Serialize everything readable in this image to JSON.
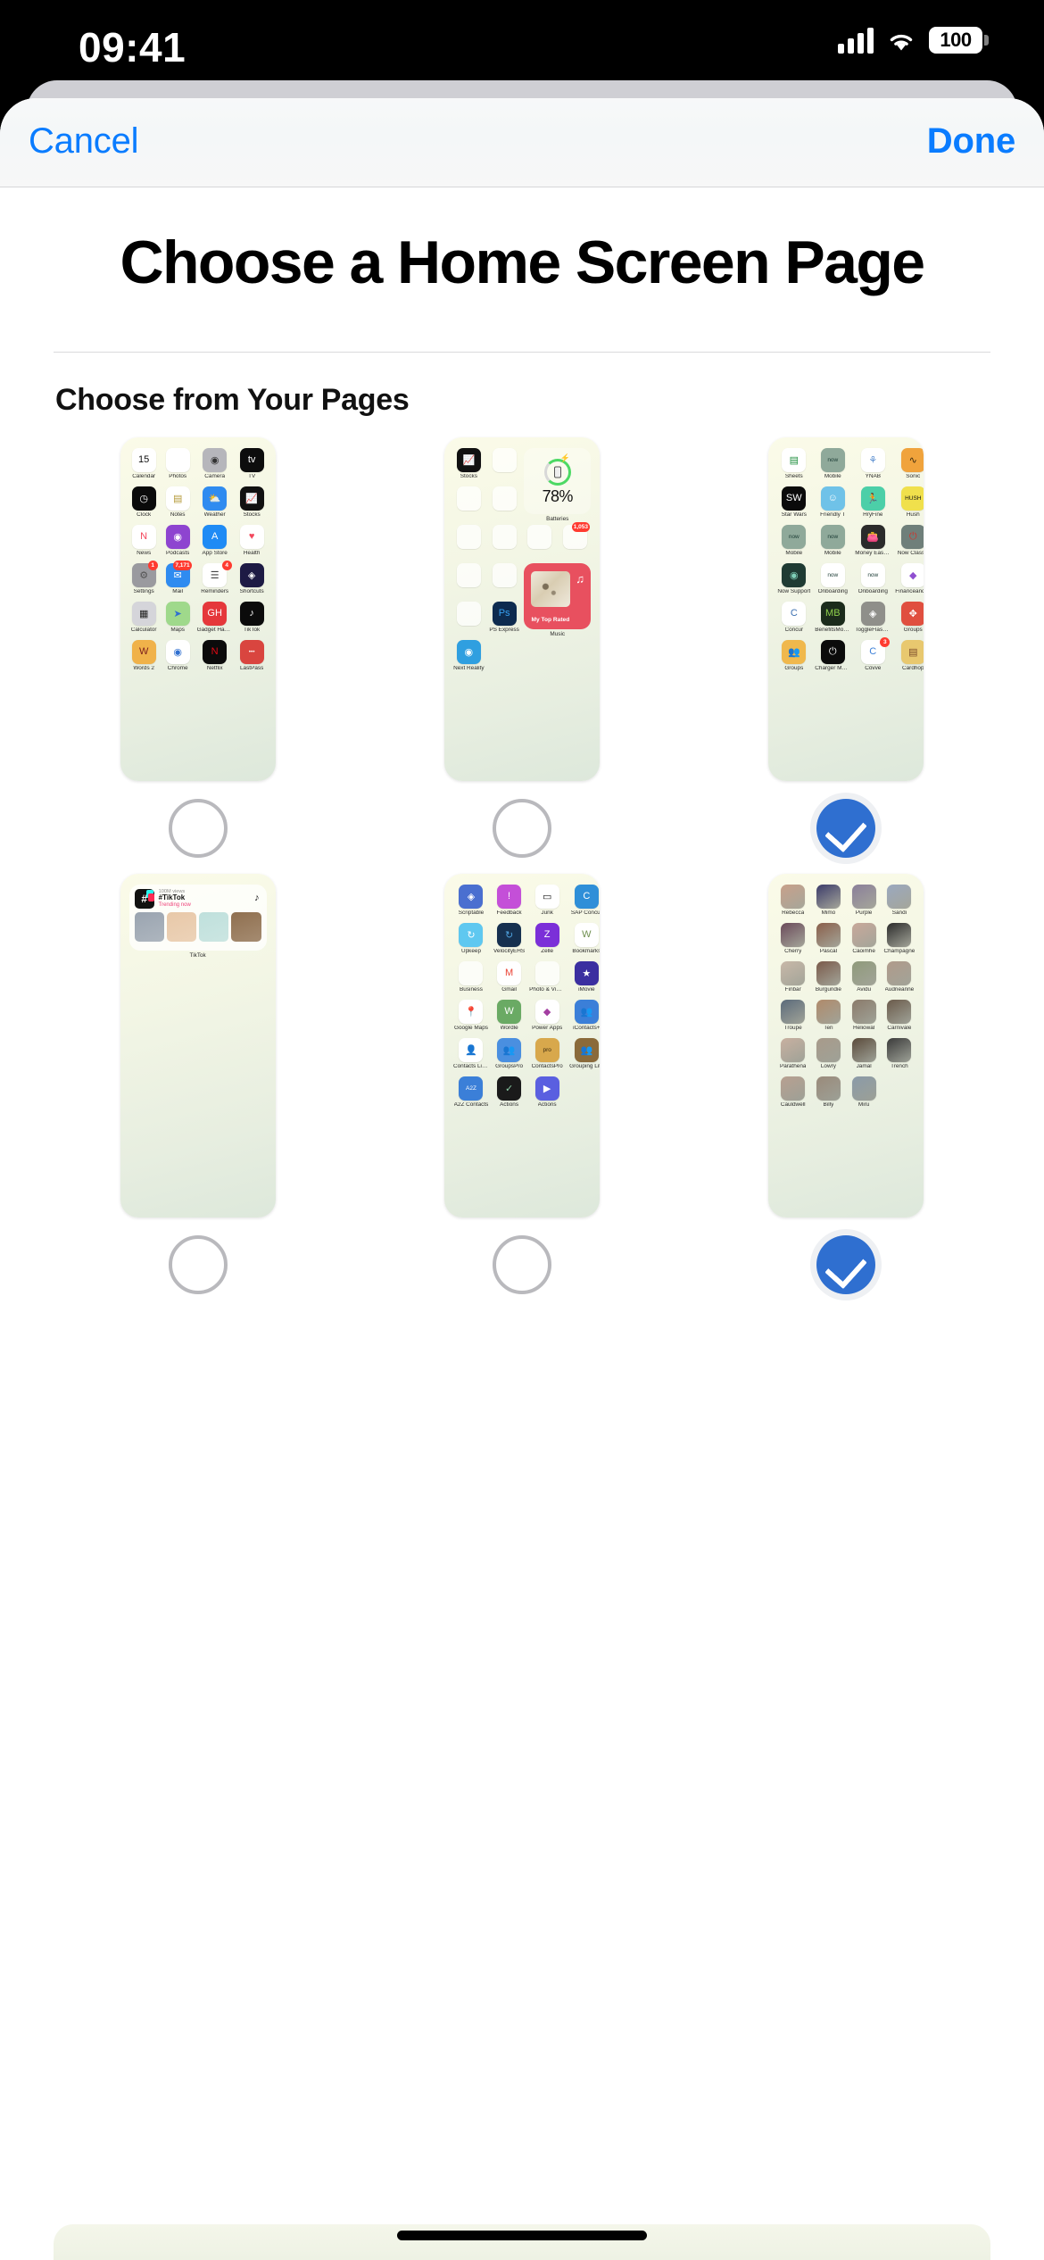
{
  "status_bar": {
    "time": "09:41",
    "battery": "100",
    "cellular_icon": "cellular-bars-icon",
    "wifi_icon": "wifi-icon"
  },
  "nav": {
    "cancel_label": "Cancel",
    "done_label": "Done"
  },
  "title": "Choose a Home Screen Page",
  "section_header": "Choose from Your Pages",
  "accent_color": "#2f6fd0",
  "link_color": "#0a7cff",
  "pages": [
    {
      "id": "page-1",
      "selected": false,
      "apps": [
        {
          "label": "Calendar",
          "icon": "calendar-icon",
          "bg": "#ffffff",
          "fg": "#111",
          "glyph": "15"
        },
        {
          "label": "Photos",
          "icon": "photos-icon",
          "bg": "#ffffff",
          "fg": "#fff",
          "glyph": "❋"
        },
        {
          "label": "Camera",
          "icon": "camera-icon",
          "bg": "#b6b6bb",
          "fg": "#333",
          "glyph": "◉"
        },
        {
          "label": "TV",
          "icon": "apple-tv-icon",
          "bg": "#0d0d0d",
          "fg": "#fff",
          "glyph": "tv"
        },
        {
          "label": "Clock",
          "icon": "clock-icon",
          "bg": "#0a0a0a",
          "fg": "#fff",
          "glyph": "◷"
        },
        {
          "label": "Notes",
          "icon": "notes-icon",
          "bg": "#ffffff",
          "fg": "#b59a3a",
          "glyph": "▤"
        },
        {
          "label": "Weather",
          "icon": "weather-icon",
          "bg": "#2f8bf0",
          "fg": "#fff",
          "glyph": "⛅"
        },
        {
          "label": "Stocks",
          "icon": "stocks-icon",
          "bg": "#111111",
          "fg": "#fff",
          "glyph": "📈"
        },
        {
          "label": "News",
          "icon": "news-icon",
          "bg": "#ffffff",
          "fg": "#f4465c",
          "glyph": "N"
        },
        {
          "label": "Podcasts",
          "icon": "podcasts-icon",
          "bg": "#8e44d0",
          "fg": "#fff",
          "glyph": "◉"
        },
        {
          "label": "App Store",
          "icon": "app-store-icon",
          "bg": "#1f8bf5",
          "fg": "#fff",
          "glyph": "A"
        },
        {
          "label": "Health",
          "icon": "health-icon",
          "bg": "#ffffff",
          "fg": "#f2485d",
          "glyph": "♥"
        },
        {
          "label": "Settings",
          "icon": "settings-icon",
          "bg": "#9a9a9f",
          "fg": "#555",
          "glyph": "⚙",
          "badge": "1"
        },
        {
          "label": "Mail",
          "icon": "mail-icon",
          "bg": "#2f8bf0",
          "fg": "#fff",
          "glyph": "✉",
          "badge": "7,171",
          "badge_wide": true
        },
        {
          "label": "Reminders",
          "icon": "reminders-icon",
          "bg": "#ffffff",
          "fg": "#444",
          "glyph": "☰",
          "badge": "4"
        },
        {
          "label": "Shortcuts",
          "icon": "shortcuts-icon",
          "bg": "#1d1a44",
          "fg": "#fff",
          "glyph": "◈"
        },
        {
          "label": "Calculator",
          "icon": "calculator-icon",
          "bg": "#d5d5da",
          "fg": "#222",
          "glyph": "▦"
        },
        {
          "label": "Maps",
          "icon": "maps-icon",
          "bg": "#9fd98b",
          "fg": "#2f6fd0",
          "glyph": "➤"
        },
        {
          "label": "Gadget Hacks",
          "icon": "gadget-hacks-icon",
          "bg": "#e5383b",
          "fg": "#fff",
          "glyph": "GH"
        },
        {
          "label": "TikTok",
          "icon": "tiktok-icon",
          "bg": "#0b0b0b",
          "fg": "#fff",
          "glyph": "♪"
        },
        {
          "label": "Words 2",
          "icon": "words-2-icon",
          "bg": "#f0b24a",
          "fg": "#7a1d1d",
          "glyph": "W"
        },
        {
          "label": "Chrome",
          "icon": "chrome-icon",
          "bg": "#ffffff",
          "fg": "#2f6fd0",
          "glyph": "◉"
        },
        {
          "label": "Netflix",
          "icon": "netflix-icon",
          "bg": "#0b0b0b",
          "fg": "#e50914",
          "glyph": "N"
        },
        {
          "label": "LastPass",
          "icon": "lastpass-icon",
          "bg": "#d9453f",
          "fg": "#fff",
          "glyph": "•••"
        }
      ]
    },
    {
      "id": "page-2",
      "selected": false,
      "apps": [
        {
          "label": "Stocks",
          "icon": "stocks-icon",
          "bg": "#111111",
          "fg": "#fff",
          "glyph": "📈"
        },
        {
          "label": "",
          "icon": "folder-icon",
          "folder": [
            "#2d6fa3",
            "#3b3b3b",
            "#222222",
            "#9bd4a8",
            "#7fcf9a",
            "#8a8a8a",
            "#3a2a2a",
            "#f0c63c",
            "#cfcfcf"
          ]
        },
        {
          "label": "Batteries",
          "icon": "batteries-widget",
          "widget": "battery",
          "value": "78%"
        },
        {
          "label": "",
          "icon": "folder-icon",
          "folder": [
            "#4fb3e8",
            "#5ac85a",
            "#6fa8dc",
            "#45c45a",
            "#6fc36f",
            "#7c4fd0",
            "#3cb44b",
            "#2f9fe0",
            "#3bb54a"
          ]
        },
        {
          "label": "",
          "icon": "folder-icon",
          "folder": [
            "#e0453b",
            "#3b7dd8",
            "#f0c040",
            "#4a7fd0",
            "#6f4fd0",
            "#2f9ecf",
            "#101010",
            "#2b2b2b",
            "#cfcfcf"
          ]
        },
        {
          "label": "",
          "icon": "folder-icon",
          "folder": [
            "#f0a33c",
            "#3f7fd0",
            "#c34f3f",
            "#6fbf5f",
            "#e8c43c",
            "#3b6fd0",
            "#f0a33c",
            "#3f9fbf",
            "#7c3fd0"
          ]
        },
        {
          "label": "",
          "icon": "folder-icon",
          "folder": [
            "#4a8fe0",
            "#e05fa8",
            "#e04848",
            "#3f4fbf",
            "#4aa3e0",
            "#f08a3c",
            "#e8a64c",
            "#3fa34c",
            "#cfcfcf"
          ]
        },
        {
          "label": "",
          "icon": "folder-icon",
          "folder": [
            "#e8d84c",
            "#e05f5f",
            "#cfd4d8",
            "#9fb0bf",
            "#4fa3e0",
            "#4fbfd0",
            "#3f8fd0",
            "#1a1a1a",
            "#cfcfcf"
          ]
        },
        {
          "label": "",
          "icon": "folder-icon",
          "badge": "1,053",
          "badge_wide": true,
          "folder": [
            "#e8e0d0",
            "#c8c0b0",
            "#e8d0b0",
            "#e8903c",
            "#e05f5f",
            "#e04848",
            "#2b2b2b",
            "#8f8f8f",
            "#6f6f6f"
          ]
        },
        {
          "label": "",
          "icon": "folder-icon",
          "folder": [
            "#e04f4f",
            "#b0b0b0",
            "#e08a4c",
            "#e8a84c",
            "#3f8fd0",
            "#e05f5f",
            "#e8d8c8",
            "#cfcfcf",
            "#cfcfcf"
          ]
        },
        {
          "label": "",
          "icon": "folder-icon",
          "folder": [
            "#3fa34c",
            "#9f9f9f",
            "#e05f7f",
            "#e0453b",
            "#cfcfcf",
            "#8fbf6f",
            "#2b2b2b",
            "#e0456f",
            "#b07fd0"
          ]
        },
        {
          "label": "Music",
          "icon": "music-widget",
          "widget": "music",
          "value": "My Top Rated"
        },
        {
          "label": "",
          "icon": "folder-icon",
          "folder": [
            "#2b2b2b",
            "#4f6f9f",
            "#3f3f3f",
            "#cfcfcf",
            "#e8a84c",
            "#4f6f8f",
            "#6f8f4f",
            "#cfcfcf",
            "#2b2b2b"
          ]
        },
        {
          "label": "PS Express",
          "icon": "ps-express-icon",
          "bg": "#0d2b4f",
          "fg": "#38a0f0",
          "glyph": "Ps"
        },
        {
          "label": "Next Reality",
          "icon": "next-reality-icon",
          "bg": "#2f9fe0",
          "fg": "#fff",
          "glyph": "◉"
        }
      ]
    },
    {
      "id": "page-3",
      "selected": true,
      "apps": [
        {
          "label": "Sheets",
          "icon": "sheets-icon",
          "bg": "#ffffff",
          "fg": "#1e8e3e",
          "glyph": "▤"
        },
        {
          "label": "Mobile",
          "icon": "now-mobile-icon",
          "bg": "#8fa99a",
          "fg": "#1b3b34",
          "glyph": "now"
        },
        {
          "label": "YNAB",
          "icon": "ynab-icon",
          "bg": "#ffffff",
          "fg": "#5b8fd0",
          "glyph": "⚘"
        },
        {
          "label": "Sonic",
          "icon": "sonic-icon",
          "bg": "#f0a33c",
          "fg": "#3a2a10",
          "glyph": "∿"
        },
        {
          "label": "Star Wars",
          "icon": "star-wars-icon",
          "bg": "#0b0b0b",
          "fg": "#fff",
          "glyph": "SW"
        },
        {
          "label": "Friendly T",
          "icon": "friendly-t-icon",
          "bg": "#6fc2e8",
          "fg": "#fff",
          "glyph": "☺"
        },
        {
          "label": "HryFine",
          "icon": "hryfine-icon",
          "bg": "#4ccfa8",
          "fg": "#fff",
          "glyph": "🏃"
        },
        {
          "label": "Hush",
          "icon": "hush-icon",
          "bg": "#f0e04c",
          "fg": "#111",
          "glyph": "HUSH"
        },
        {
          "label": "Mobile",
          "icon": "now-mobile-icon",
          "bg": "#8fa99a",
          "fg": "#1b3b34",
          "glyph": "now"
        },
        {
          "label": "Mobile",
          "icon": "now-mobile-icon",
          "bg": "#8fa99a",
          "fg": "#1b3b34",
          "glyph": "now"
        },
        {
          "label": "Money Easy Lite",
          "icon": "money-easy-lite-icon",
          "bg": "#2b2b2b",
          "fg": "#e8a84c",
          "glyph": "👛"
        },
        {
          "label": "Now Classic",
          "icon": "now-classic-icon",
          "bg": "#6f7f7a",
          "fg": "#d0342c",
          "glyph": "⏻"
        },
        {
          "label": "Now Support",
          "icon": "now-support-icon",
          "bg": "#1f3b33",
          "fg": "#7fd0b8",
          "glyph": "◉"
        },
        {
          "label": "Onboarding",
          "icon": "onboarding-icon",
          "bg": "#ffffff",
          "fg": "#1b3b34",
          "glyph": "now"
        },
        {
          "label": "Onboarding",
          "icon": "onboarding-icon",
          "bg": "#ffffff",
          "fg": "#1b3b34",
          "glyph": "now"
        },
        {
          "label": "FinanceandOp...",
          "icon": "finance-and-op-icon",
          "bg": "#ffffff",
          "fg": "#8f4fd0",
          "glyph": "◆"
        },
        {
          "label": "Concur",
          "icon": "concur-icon",
          "bg": "#ffffff",
          "fg": "#3b6fb0",
          "glyph": "C"
        },
        {
          "label": "BenefitsMobile",
          "icon": "benefits-mobile-icon",
          "bg": "#1b2b1b",
          "fg": "#8fd04c",
          "glyph": "MB"
        },
        {
          "label": "ToggleFlashAl...",
          "icon": "toggle-flash-icon",
          "bg": "#8f8f8a",
          "fg": "#fff",
          "glyph": "◈"
        },
        {
          "label": "Groups",
          "icon": "groups-icon",
          "bg": "#e04f3f",
          "fg": "#fff",
          "glyph": "✥"
        },
        {
          "label": "Groups",
          "icon": "groups-icon",
          "bg": "#f0b84c",
          "fg": "#fff",
          "glyph": "👥"
        },
        {
          "label": "Charger Master",
          "icon": "charger-master-icon",
          "bg": "#0b0b0b",
          "fg": "#fff",
          "glyph": "⏻"
        },
        {
          "label": "Covve",
          "icon": "covve-icon",
          "bg": "#ffffff",
          "fg": "#3b7fd8",
          "glyph": "C",
          "badge": "3"
        },
        {
          "label": "Cardhop",
          "icon": "cardhop-icon",
          "bg": "#e8c86f",
          "fg": "#7a4a2a",
          "glyph": "▤"
        }
      ]
    },
    {
      "id": "page-4",
      "selected": false,
      "widget_only": true,
      "widget": {
        "type": "tiktok",
        "label": "TikTok",
        "views": "100M views",
        "tag": "#TikTok",
        "trending": "Trending now",
        "thumb_colors": [
          "#9aa4b0",
          "#e8c8a8",
          "#bfe0dc",
          "#8f6f4f"
        ]
      },
      "apps": []
    },
    {
      "id": "page-5",
      "selected": false,
      "apps": [
        {
          "label": "Scriptable",
          "icon": "scriptable-icon",
          "bg": "#4a6fd0",
          "fg": "#fff",
          "glyph": "◈"
        },
        {
          "label": "Feedback",
          "icon": "feedback-icon",
          "bg": "#c44fd8",
          "fg": "#fff",
          "glyph": "!"
        },
        {
          "label": "Junk",
          "icon": "junk-icon",
          "bg": "#ffffff",
          "fg": "#111",
          "glyph": "▭"
        },
        {
          "label": "SAP Concur",
          "icon": "sap-concur-icon",
          "bg": "#2f8fd8",
          "fg": "#fff",
          "glyph": "C"
        },
        {
          "label": "Upkeep",
          "icon": "upkeep-icon",
          "bg": "#5fc8f0",
          "fg": "#fff",
          "glyph": "↻"
        },
        {
          "label": "VelocityEHS",
          "icon": "velocity-ehs-icon",
          "bg": "#16304f",
          "fg": "#4fa3e0",
          "glyph": "↻"
        },
        {
          "label": "Zelle",
          "icon": "zelle-icon",
          "bg": "#7b2fd8",
          "fg": "#fff",
          "glyph": "Z"
        },
        {
          "label": "Bookmarks",
          "icon": "bookmarks-icon",
          "bg": "#ffffff",
          "fg": "#6f8f4f",
          "glyph": "W"
        },
        {
          "label": "Business",
          "icon": "business-folder-icon",
          "folder": [
            "#1a1a1a",
            "#e07f7f",
            "#2b2b2b",
            "#cfcfcf",
            "#cfcfcf",
            "#cfcfcf",
            "#cfcfcf",
            "#cfcfcf",
            "#cfcfcf"
          ]
        },
        {
          "label": "Gmail",
          "icon": "gmail-icon",
          "bg": "#ffffff",
          "fg": "#ea4335",
          "glyph": "M"
        },
        {
          "label": "Photo & Video",
          "icon": "photo-video-folder-icon",
          "folder": [
            "#8f8f8f",
            "#4fa3e0",
            "#cfcfcf",
            "#cfcfcf",
            "#cfcfcf",
            "#cfcfcf",
            "#cfcfcf",
            "#cfcfcf",
            "#cfcfcf"
          ]
        },
        {
          "label": "iMovie",
          "icon": "imovie-icon",
          "bg": "#3b2fa0",
          "fg": "#fff",
          "glyph": "★"
        },
        {
          "label": "Google Maps",
          "icon": "google-maps-icon",
          "bg": "#ffffff",
          "fg": "#34a853",
          "glyph": "📍"
        },
        {
          "label": "Wordle",
          "icon": "wordle-icon",
          "bg": "#6aaa64",
          "fg": "#fff",
          "glyph": "W"
        },
        {
          "label": "Power Apps",
          "icon": "power-apps-icon",
          "bg": "#ffffff",
          "fg": "#a33ea1",
          "glyph": "◆"
        },
        {
          "label": "iContacts+",
          "icon": "icontacts-plus-icon",
          "bg": "#3b7fd8",
          "fg": "#fff",
          "glyph": "👥"
        },
        {
          "label": "Contacts List Pro",
          "icon": "contacts-list-pro-icon",
          "bg": "#ffffff",
          "fg": "#e8a84c",
          "glyph": "👤"
        },
        {
          "label": "GroupsPro",
          "icon": "groups-pro-icon",
          "bg": "#4a8fe0",
          "fg": "#fff",
          "glyph": "👥"
        },
        {
          "label": "ContactsPro",
          "icon": "contacts-pro-icon",
          "bg": "#d8a84c",
          "fg": "#3a2a10",
          "glyph": "pro"
        },
        {
          "label": "Grouping Lite",
          "icon": "grouping-lite-icon",
          "bg": "#8a6a3a",
          "fg": "#fff",
          "glyph": "👥"
        },
        {
          "label": "A2Z Contacts",
          "icon": "a2z-contacts-icon",
          "bg": "#3b7fd8",
          "fg": "#fff",
          "glyph": "A2Z"
        },
        {
          "label": "Actions",
          "icon": "actions-icon",
          "bg": "#1a1a1a",
          "fg": "#8fd0a8",
          "glyph": "✓"
        },
        {
          "label": "Actions",
          "icon": "actions-play-icon",
          "bg": "#5a5fe0",
          "fg": "#fff",
          "glyph": "▶"
        }
      ]
    },
    {
      "id": "page-6",
      "selected": true,
      "contacts": true,
      "apps": [
        {
          "label": "Rebecca",
          "icon": "contact-photo",
          "photo": "#c8a08a"
        },
        {
          "label": "Mimo",
          "icon": "contact-photo",
          "photo": "#3b3b6a"
        },
        {
          "label": "Purple",
          "icon": "contact-photo",
          "photo": "#8a7f9a"
        },
        {
          "label": "Sandi",
          "icon": "contact-photo",
          "photo": "#9aa8bf"
        },
        {
          "label": "Cherry",
          "icon": "contact-photo",
          "photo": "#6a4a5a"
        },
        {
          "label": "Pascal",
          "icon": "contact-photo",
          "photo": "#8a5f4a"
        },
        {
          "label": "Caoimhe",
          "icon": "contact-photo",
          "photo": "#c8a89a"
        },
        {
          "label": "Champagne",
          "icon": "contact-photo",
          "photo": "#2b2b2b"
        },
        {
          "label": "Finbar",
          "icon": "contact-photo",
          "photo": "#c8b8a8"
        },
        {
          "label": "Burgundie",
          "icon": "contact-photo",
          "photo": "#7a5a4a"
        },
        {
          "label": "Avidu",
          "icon": "contact-photo",
          "photo": "#8f9a7a"
        },
        {
          "label": "Audrieanne",
          "icon": "contact-photo",
          "photo": "#b09a8a"
        },
        {
          "label": "Troupe",
          "icon": "contact-photo",
          "photo": "#5a6a7a"
        },
        {
          "label": "Teri",
          "icon": "contact-photo",
          "photo": "#b08a6a"
        },
        {
          "label": "Heliowal",
          "icon": "contact-photo",
          "photo": "#8a7a6a"
        },
        {
          "label": "Carnivale",
          "icon": "contact-photo",
          "photo": "#6a5a4a"
        },
        {
          "label": "Parathena",
          "icon": "contact-photo",
          "photo": "#c8b0a0"
        },
        {
          "label": "Lowry",
          "icon": "contact-photo",
          "photo": "#a89a8a"
        },
        {
          "label": "Jamal",
          "icon": "contact-photo",
          "photo": "#5a4a3a"
        },
        {
          "label": "Trench",
          "icon": "contact-photo",
          "photo": "#3a3a3a"
        },
        {
          "label": "Cauldwell",
          "icon": "contact-photo",
          "photo": "#b8a090"
        },
        {
          "label": "Billy",
          "icon": "contact-photo",
          "photo": "#9a8a7a"
        },
        {
          "label": "Miru",
          "icon": "contact-photo",
          "photo": "#8a9aa8"
        }
      ]
    }
  ]
}
